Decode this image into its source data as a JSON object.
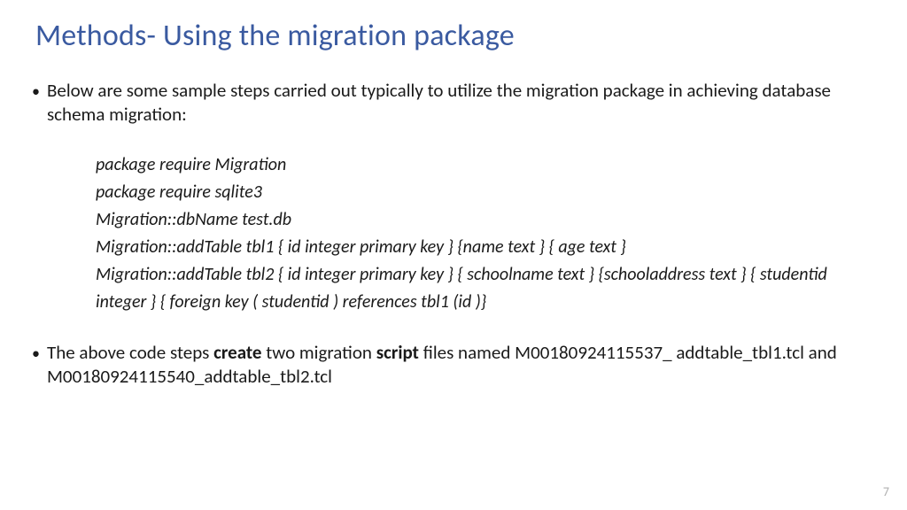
{
  "title": "Methods- Using the migration package",
  "bullets": {
    "intro": "Below are some sample steps carried out typically to utilize the migration package in achieving database schema migration:",
    "code": [
      "package require Migration",
      "package require sqlite3",
      "Migration::dbName test.db",
      "Migration::addTable tbl1 { id integer primary key } {name text } { age text }",
      "Migration::addTable tbl2 { id integer primary key } { schoolname text } {schooladdress text } { studentid integer } { foreign key ( studentid ) references tbl1 (id )}"
    ],
    "outro_pre": "The above code steps ",
    "outro_b1": "create",
    "outro_mid": " two migration ",
    "outro_b2": "script",
    "outro_post": " files named M00180924115537_ addtable_tbl1.tcl and M00180924115540_addtable_tbl2.tcl"
  },
  "pageNumber": "7"
}
